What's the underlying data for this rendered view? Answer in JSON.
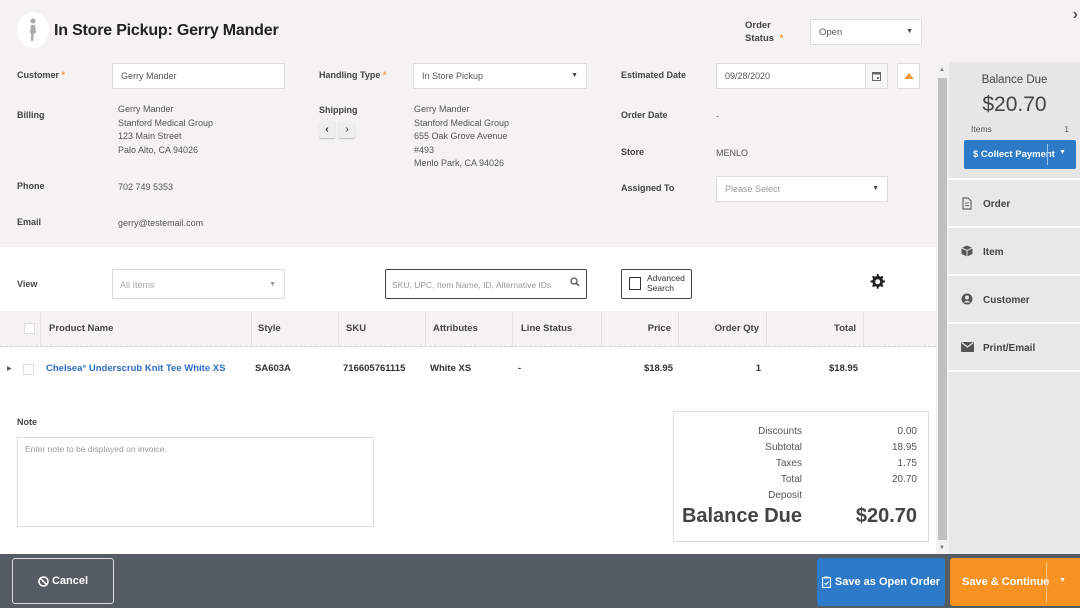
{
  "header": {
    "title": "In Store Pickup: Gerry Mander",
    "order_status_label": "Order Status",
    "required_mark": "*",
    "order_status_value": "Open",
    "close_glyph": "›"
  },
  "form": {
    "customer_label": "Customer",
    "customer_value": "Gerry Mander",
    "billing_label": "Billing",
    "billing_lines": [
      "Gerry Mander",
      "Stanford Medical Group",
      "123 Main Street",
      "Palo Alto, CA 94026"
    ],
    "phone_label": "Phone",
    "phone_value": "702 749 5353",
    "email_label": "Email",
    "email_value": "gerry@testemail.com",
    "handling_label": "Handling Type",
    "handling_value": "In Store Pickup",
    "shipping_label": "Shipping",
    "shipping_lines": [
      "Gerry Mander",
      "Stanford Medical Group",
      "655 Oak Grove Avenue",
      "#493",
      "Menlo Park, CA 94026"
    ],
    "prev_glyph": "‹",
    "next_glyph": "›",
    "estimated_label": "Estimated Date",
    "estimated_value": "09/28/2020",
    "order_date_label": "Order Date",
    "order_date_value": "-",
    "store_label": "Store",
    "store_value": "MENLO",
    "assigned_label": "Assigned To",
    "assigned_placeholder": "Please Select"
  },
  "items": {
    "view_label": "View",
    "view_value": "All Items",
    "search_placeholder": "SKU, UPC, Item Name, ID, Alternative IDs",
    "advanced_line1": "Advanced",
    "advanced_line2": "Search",
    "columns": [
      "Product Name",
      "Style",
      "SKU",
      "Attributes",
      "Line Status",
      "Price",
      "Order Qty",
      "Total"
    ],
    "rows": [
      {
        "product": "Chelsea° Underscrub Knit Tee White XS",
        "style": "SA603A",
        "sku": "716605761115",
        "attributes": "White XS",
        "line_status": "-",
        "price": "$18.95",
        "qty": "1",
        "total": "$18.95"
      }
    ],
    "note_label": "Note",
    "note_placeholder": "Enter note to be displayed on invoice."
  },
  "totals": {
    "discounts_label": "Discounts",
    "discounts_value": "0.00",
    "subtotal_label": "Subtotal",
    "subtotal_value": "18.95",
    "taxes_label": "Taxes",
    "taxes_value": "1.75",
    "total_label": "Total",
    "total_value": "20.70",
    "deposit_label": "Deposit",
    "deposit_value": "",
    "balance_label": "Balance Due",
    "balance_value": "$20.70"
  },
  "sidebar": {
    "balance_title": "Balance Due",
    "balance_amount": "$20.70",
    "items_label": "Items",
    "items_count": "1",
    "collect_label": "$ Collect Payment",
    "nav": [
      {
        "label": "Order",
        "icon": "document-icon"
      },
      {
        "label": "Item",
        "icon": "box-icon"
      },
      {
        "label": "Customer",
        "icon": "user-icon"
      },
      {
        "label": "Print/Email",
        "icon": "envelope-icon"
      }
    ]
  },
  "footer": {
    "cancel_label": "Cancel",
    "save_open_label": "Save as Open Order",
    "save_continue_label": "Save & Continue"
  },
  "colors": {
    "primary_blue": "#2c7ac8",
    "accent_orange": "#f79223",
    "link_blue": "#2d6fc4",
    "footer_bg": "#555c63"
  }
}
